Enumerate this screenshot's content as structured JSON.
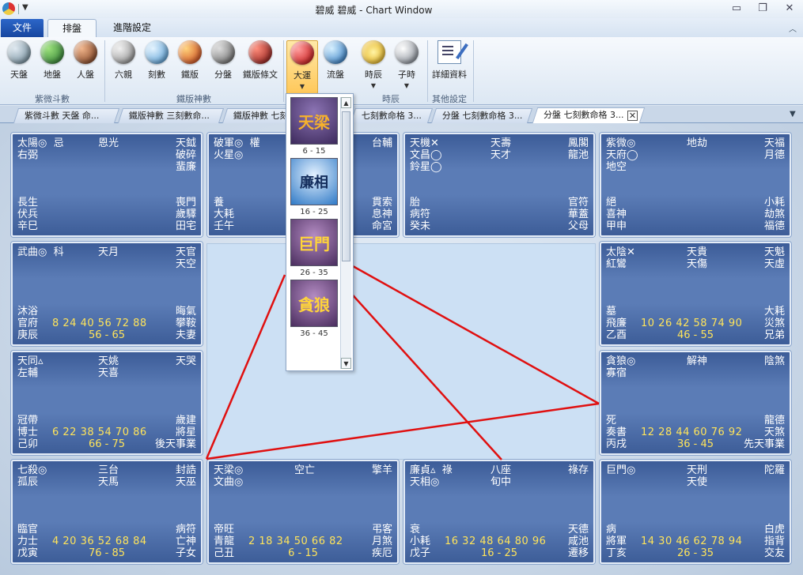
{
  "window": {
    "title": "碧威 碧威 - Chart Window"
  },
  "ribbon": {
    "tabs": {
      "file": "文件",
      "layout": "排盤",
      "advanced": "進階設定"
    },
    "groups": {
      "ziwei": {
        "label": "紫微斗數",
        "buttons": [
          "天盤",
          "地盤",
          "人盤"
        ]
      },
      "tieban": {
        "label": "鐵版神數",
        "buttons": [
          "六親",
          "刻數",
          "鐵版",
          "分盤",
          "鐵版條文"
        ]
      },
      "time": {
        "label": "時辰",
        "buttons": [
          "大運",
          "流盤",
          "時辰",
          "子時"
        ]
      },
      "other": {
        "label": "其他設定",
        "buttons": [
          "詳細資料"
        ]
      }
    }
  },
  "doc_tabs": [
    "紫微斗數 天盤 命...",
    "鐵版神數 三刻數命...",
    "鐵版神數 七刻",
    "七刻數命格 3...",
    "分盤 七刻數命格 3...",
    "分盤 七刻數命格 3..."
  ],
  "gallery": [
    {
      "text": "天梁",
      "label": "6 - 15"
    },
    {
      "text": "廉相",
      "label": "16 - 25"
    },
    {
      "text": "巨門",
      "label": "26 - 35"
    },
    {
      "text": "貪狼",
      "label": "36 - 45"
    }
  ],
  "palaces": [
    {
      "id": "si",
      "tl": "太陽◎  忌\n右弼",
      "tm": "恩光",
      "tr": "天鉞\n破碎\n蜚廉",
      "bl": "長生\n伏兵\n辛巳",
      "br": "喪門\n歲驛\n田宅",
      "ages": "",
      "range": ""
    },
    {
      "id": "wu",
      "tl": "破軍◎  權\n火星◎",
      "tm": "",
      "tr": "台輔",
      "bl": "養\n大耗\n壬午",
      "br": "貫索\n息神\n命宮",
      "ages": "",
      "range": ""
    },
    {
      "id": "wei",
      "tl": "天機✕\n文昌◯\n鈴星◯",
      "tm": "天壽\n天才",
      "tr": "鳳閣\n龍池",
      "bl": "胎\n病符\n癸未",
      "br": "官符\n華蓋\n父母",
      "ages": "",
      "range": ""
    },
    {
      "id": "shen",
      "tl": "紫微◎\n天府◯\n地空",
      "tm": "地劫",
      "tr": "天福\n月德",
      "bl": "絕\n喜神\n甲申",
      "br": "小耗\n劫煞\n福德",
      "ages": "",
      "range": ""
    },
    {
      "id": "chen",
      "tl": "武曲◎  科",
      "tm": "天月",
      "tr": "天官\n天空",
      "bl": "沐浴\n官府\n庚辰",
      "br": "晦氣\n攀鞍\n夫妻",
      "ages": "8 24 40 56 72 88",
      "range": "56 - 65"
    },
    {
      "id": "you",
      "tl": "太陰✕\n紅鸞",
      "tm": "天貴\n天傷",
      "tr": "天魁\n天虛",
      "bl": "墓\n飛廉\n乙酉",
      "br": "大耗\n災煞\n兄弟",
      "ages": "10 26 42 58 74 90",
      "range": "46 - 55"
    },
    {
      "id": "mao",
      "tl": "天同▵\n左輔",
      "tm": "天姚\n天喜",
      "tr": "天哭",
      "bl": "冠帶\n博士\n己卯",
      "br": "歲建\n將星\n後天事業",
      "ages": "6 22 38 54 70 86",
      "range": "66 - 75"
    },
    {
      "id": "xu",
      "tl": "貪狼◎\n寡宿",
      "tm": "解神",
      "tr": "陰煞",
      "bl": "死\n奏書\n丙戌",
      "br": "龍德\n天煞\n先天事業",
      "ages": "12 28 44 60 76 92",
      "range": "36 - 45"
    },
    {
      "id": "yin",
      "tl": "七殺◎\n孤辰",
      "tm": "三台\n天馬",
      "tr": "封誥\n天巫",
      "bl": "臨官\n力士\n戊寅",
      "br": "病符\n亡神\n子女",
      "ages": "4 20 36 52 68 84",
      "range": "76 - 85"
    },
    {
      "id": "chou",
      "tl": "天梁◎\n文曲◎",
      "tm": "空亡",
      "tr": "擎羊",
      "bl": "帝旺\n青龍\n己丑",
      "br": "弔客\n月煞\n疾厄",
      "ages": "2 18 34 50 66 82",
      "range": "6 - 15"
    },
    {
      "id": "zi",
      "tl": "廉貞▵  祿\n天相◎",
      "tm": "八座\n旬中",
      "tr": "祿存",
      "bl": "衰\n小耗\n戊子",
      "br": "天德\n咸池\n遷移",
      "ages": "16 32 48 64 80 96",
      "range": "16 - 25"
    },
    {
      "id": "hai",
      "tl": "巨門◎",
      "tm": "天刑\n天使",
      "tr": "陀羅",
      "bl": "病\n將軍\n丁亥",
      "br": "白虎\n指背\n交友",
      "ages": "14 30 46 62 78 94",
      "range": "26 - 35"
    }
  ]
}
